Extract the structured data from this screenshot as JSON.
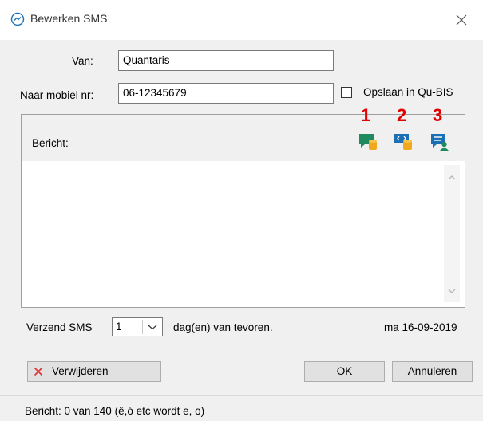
{
  "window": {
    "title": "Bewerken SMS"
  },
  "form": {
    "from_label": "Van:",
    "from_value": "Quantaris",
    "to_label": "Naar mobiel nr:",
    "to_value": "06-12345679",
    "save_label": "Opslaan in Qu-BIS",
    "save_checked": false
  },
  "message": {
    "label": "Bericht:",
    "body": "",
    "toolbar": [
      {
        "number": "1",
        "icon": "message-database-icon"
      },
      {
        "number": "2",
        "icon": "code-database-icon"
      },
      {
        "number": "3",
        "icon": "message-user-icon"
      }
    ]
  },
  "schedule": {
    "send_label": "Verzend SMS",
    "days_value": "1",
    "days_suffix": "dag(en) van tevoren.",
    "date": "ma 16-09-2019"
  },
  "buttons": {
    "delete_label": "Verwijderen",
    "ok_label": "OK",
    "cancel_label": "Annuleren"
  },
  "status": {
    "text": "Bericht: 0 van 140 (ë,ó etc wordt e, o)"
  },
  "colors": {
    "accent": "#1a6fb5",
    "annotation": "#e00000",
    "icon_green": "#1e8a5e",
    "icon_orange": "#f0a81e"
  }
}
